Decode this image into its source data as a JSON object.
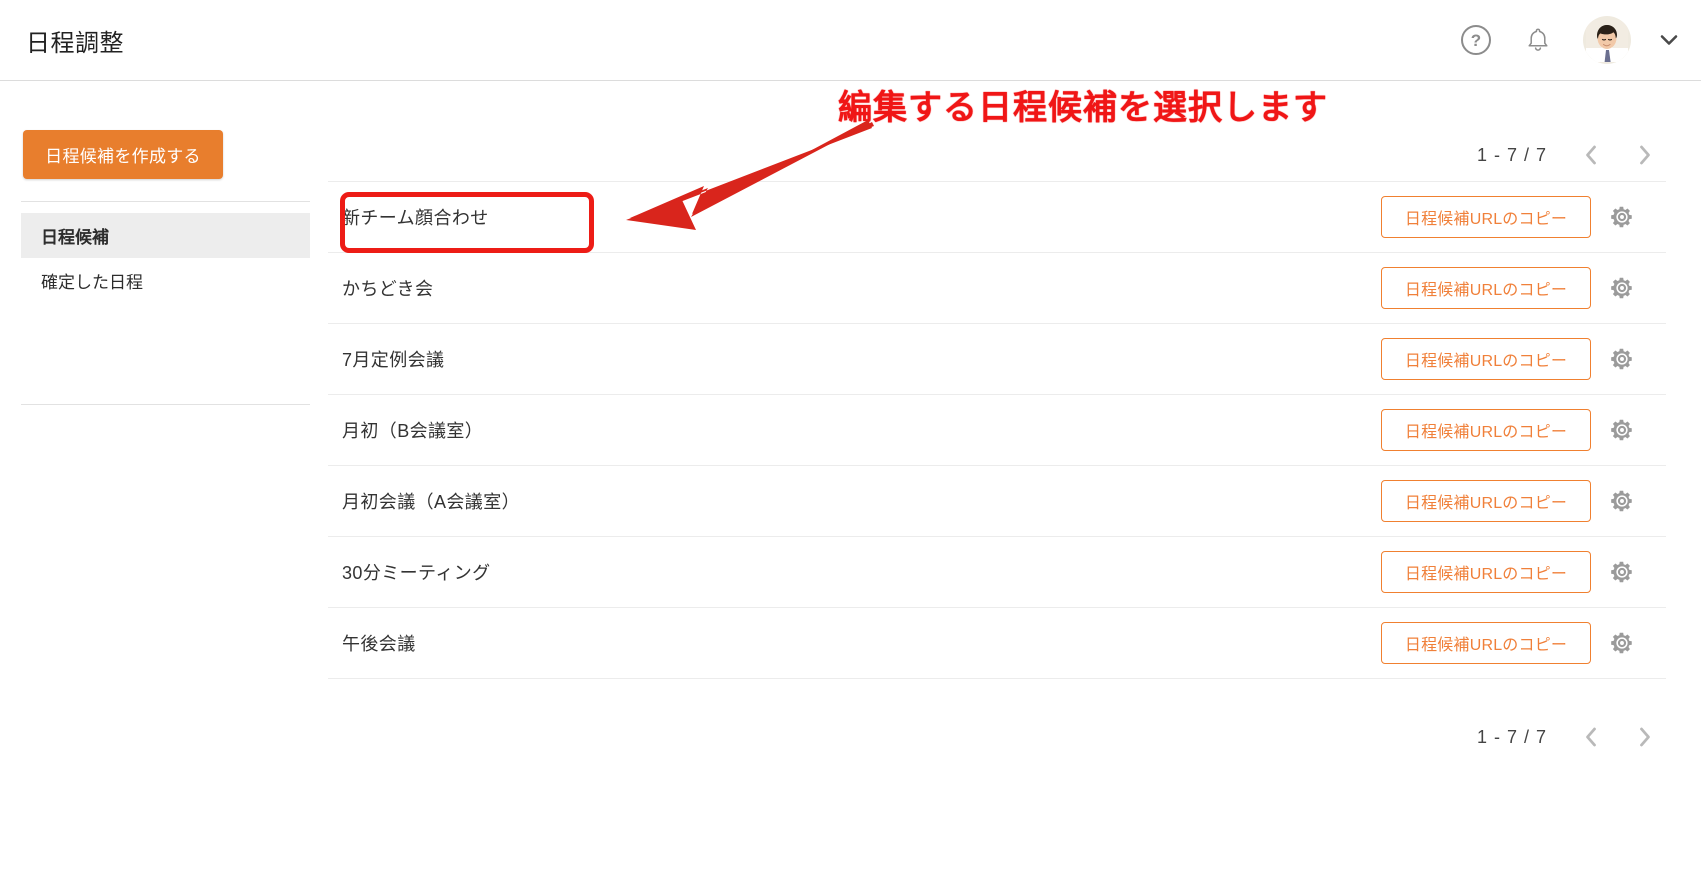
{
  "header": {
    "title": "日程調整",
    "icons": {
      "help": "help-circle-icon",
      "help_glyph": "?",
      "bell": "bell-icon",
      "avatar": "user-avatar",
      "chevron": "chevron-down-icon"
    }
  },
  "sidebar": {
    "create_button_label": "日程候補を作成する",
    "items": [
      {
        "label": "日程候補",
        "active": true
      },
      {
        "label": "確定した日程",
        "active": false
      }
    ]
  },
  "main": {
    "pagination": {
      "range_label": "1 - 7 / 7",
      "prev_icon": "chevron-left-icon",
      "next_icon": "chevron-right-icon"
    },
    "row_action": {
      "copy_url_label": "日程候補URLのコピー",
      "settings_icon": "gear-icon"
    },
    "rows": [
      {
        "title": "新チーム顔合わせ"
      },
      {
        "title": "かちどき会"
      },
      {
        "title": "7月定例会議"
      },
      {
        "title": "月初（B会議室）"
      },
      {
        "title": "月初会議（A会議室）"
      },
      {
        "title": "30分ミーティング"
      },
      {
        "title": "午後会議"
      }
    ]
  },
  "annotations": {
    "callout_text": "編集する日程候補を選択します",
    "highlight_target": "新チーム顔合わせ",
    "arrow_icon": "arrow-pointing-down-left"
  },
  "colors": {
    "brand_orange": "#e87e2d",
    "button_outline_orange": "#f08030",
    "annotation_red": "#ed1c16",
    "active_nav_bg": "#ededed",
    "divider": "#ececec"
  }
}
